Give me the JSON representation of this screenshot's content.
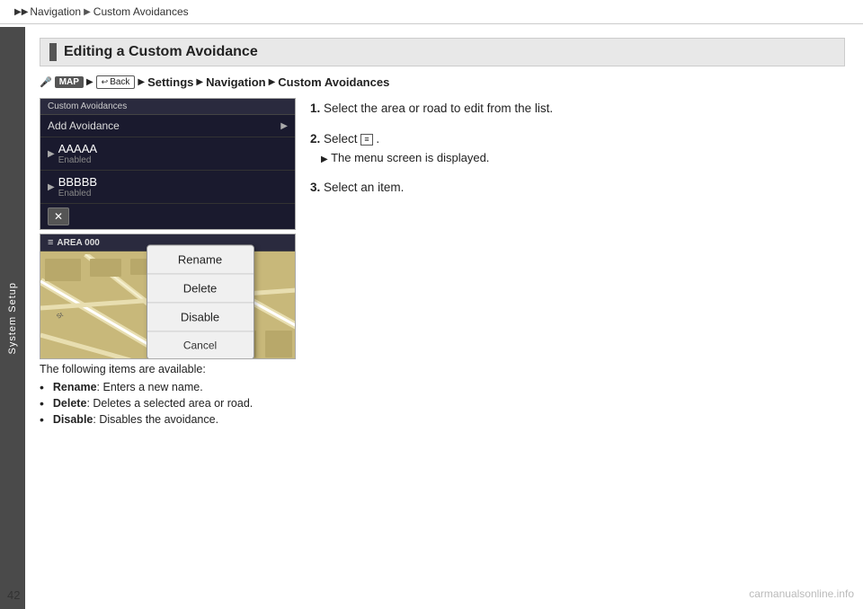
{
  "topbar": {
    "breadcrumbs": [
      "Navigation",
      "Custom Avoidances"
    ],
    "arrows": [
      "▶▶",
      "▶"
    ]
  },
  "sidebar": {
    "label": "System Setup"
  },
  "section": {
    "heading": "Editing a Custom Avoidance"
  },
  "instruction_row": {
    "icon_label": "MAP",
    "back_label": "Back",
    "steps": [
      "Settings",
      "Navigation",
      "Custom Avoidances"
    ]
  },
  "screen1": {
    "header": "Custom Avoidances",
    "add_item": "Add Avoidance",
    "items": [
      {
        "name": "AAAAA",
        "status": "Enabled"
      },
      {
        "name": "BBBBB",
        "status": "Enabled"
      }
    ]
  },
  "screen2": {
    "area_label": "AREA 000"
  },
  "context_menu": {
    "items": [
      "Rename",
      "Delete",
      "Disable",
      "Cancel"
    ]
  },
  "caption": "The following items are available:",
  "bullets": [
    {
      "label": "Rename",
      "text": ": Enters a new name."
    },
    {
      "label": "Delete",
      "text": ": Deletes a selected area or road."
    },
    {
      "label": "Disable",
      "text": ": Disables the avoidance."
    }
  ],
  "steps": [
    {
      "num": "1.",
      "text": "Select the area or road to edit from the list."
    },
    {
      "num": "2.",
      "text": "Select ",
      "icon": "≡",
      "after": ".",
      "sub_arrow": "▶",
      "sub_text": "The menu screen is displayed."
    },
    {
      "num": "3.",
      "text": "Select an item."
    }
  ],
  "page_number": "42",
  "watermark": "carmanualsonline.info"
}
